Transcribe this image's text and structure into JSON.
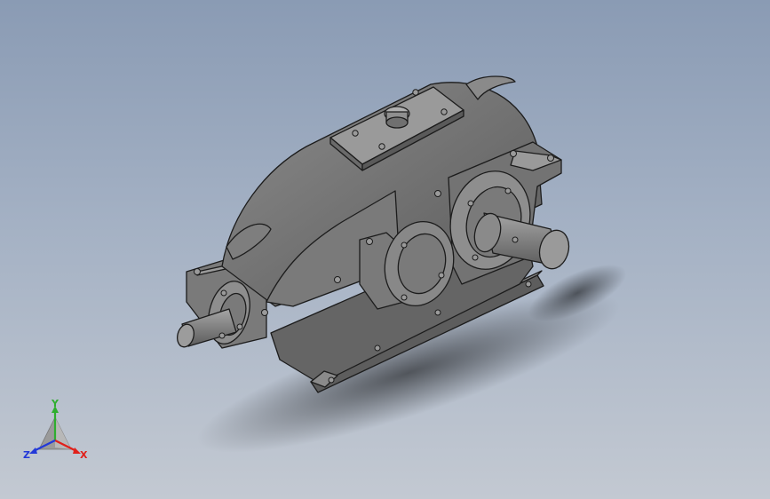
{
  "viewport": {
    "background_top": "#8a9bb4",
    "background_bottom": "#c3c9d2"
  },
  "model": {
    "description_icon": "gear-reducer-model",
    "body_color": "#6f6f6f",
    "edge_color": "#1c1c1c"
  },
  "triad": {
    "x_label": "X",
    "y_label": "Y",
    "z_label": "Z",
    "x_color": "#e0201a",
    "y_color": "#2fae2f",
    "z_color": "#2339d8"
  }
}
